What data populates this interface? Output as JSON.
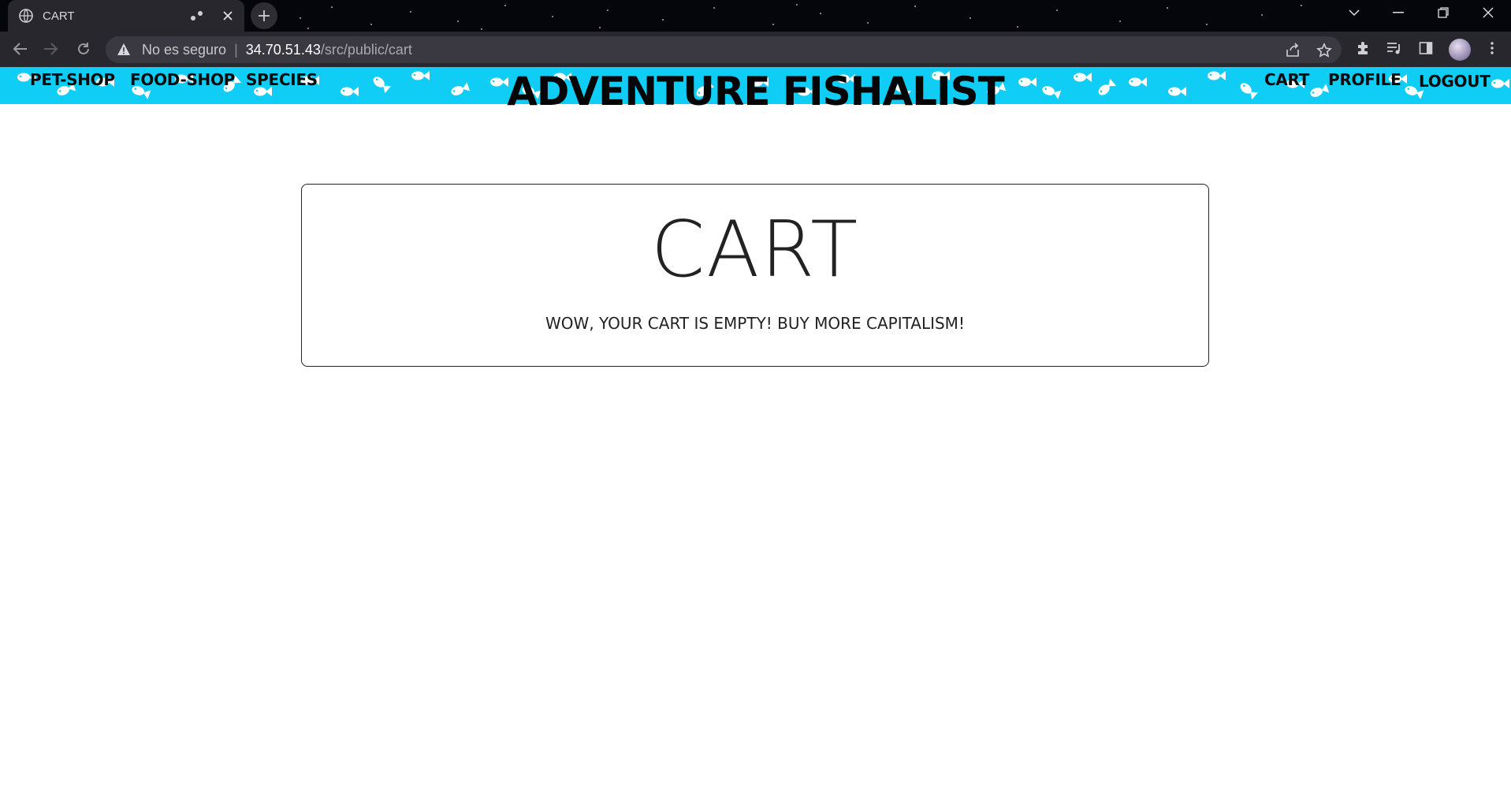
{
  "browser": {
    "tab_title": "CART",
    "security_label": "No es seguro",
    "url_host": "34.70.51.43",
    "url_path": "/src/public/cart"
  },
  "site": {
    "brand": "ADVENTURE FISHALIST",
    "nav_left": [
      "PET-SHOP",
      "FOOD-SHOP",
      "SPECIES"
    ],
    "nav_right": [
      "CART",
      "PROFILE",
      "LOGOUT"
    ],
    "header_color": "#10cdf6"
  },
  "cart": {
    "title": "CART",
    "empty_message": "WOW, YOUR CART IS EMPTY! BUY MORE CAPITALISM!"
  }
}
